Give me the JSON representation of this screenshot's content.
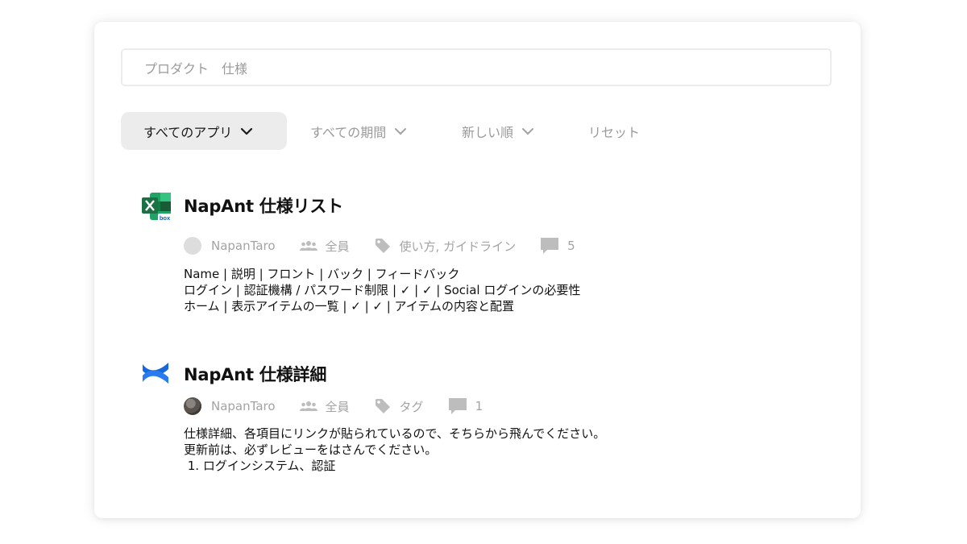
{
  "search": {
    "value": "プロダクト　仕様"
  },
  "filters": [
    {
      "label": "すべてのアプリ",
      "active": true
    },
    {
      "label": "すべての期間",
      "active": false
    },
    {
      "label": "新しい順",
      "active": false
    },
    {
      "label": "リセット",
      "active": false
    }
  ],
  "results": [
    {
      "app_icon": "excel-box-icon",
      "title": "NapAnt 仕様リスト",
      "author": "NapanTaro",
      "audience": "全員",
      "tags": "使い方, ガイドライン",
      "comments": "5",
      "snippet": [
        "Name | 説明 | フロント | バック | フィードバック",
        "ログイン | 認証機構 / パスワード制限 | ✓ | ✓ | Social ログインの必要性",
        "ホーム | 表示アイテムの一覧 | ✓ | ✓ | アイテムの内容と配置"
      ]
    },
    {
      "app_icon": "confluence-icon",
      "title": "NapAnt 仕様詳細",
      "author": "NapanTaro",
      "audience": "全員",
      "tags": "タグ",
      "comments": "1",
      "snippet": [
        "仕様詳細、各項目にリンクが貼られているので、そちらから飛んでください。",
        "更新前は、必ずレビューをはさんでください。",
        " 1. ログインシステム、認証"
      ]
    }
  ],
  "colors": {
    "excel_green": "#1D7044",
    "confluence_blue": "#1868DB",
    "box_blue": "#0061D5",
    "muted_text": "#a3a3a3"
  }
}
